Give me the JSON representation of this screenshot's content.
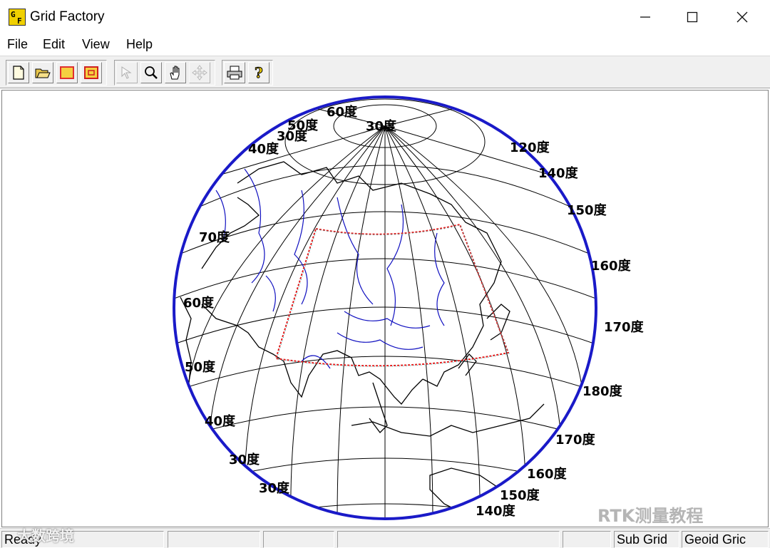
{
  "window": {
    "title": "Grid Factory",
    "icon": "grid-factory-icon",
    "icon_letters": [
      "G",
      "F"
    ],
    "controls": [
      "minimize",
      "maximize",
      "close"
    ]
  },
  "menu": [
    "File",
    "Edit",
    "View",
    "Help"
  ],
  "toolbar": {
    "groups": [
      [
        "new-file-icon",
        "open-folder-icon",
        "rectangle-icon",
        "sub-rectangle-icon"
      ],
      [
        "select-arrow-icon",
        "zoom-magnifier-icon",
        "pan-hand-icon",
        "move-crosshair-icon"
      ],
      [
        "print-icon",
        "help-question-icon"
      ]
    ]
  },
  "map": {
    "projection": "orthographic globe",
    "colors": {
      "coastline": "#000000",
      "rivers": "#1010c0",
      "rim": "#1a1ac8",
      "grid_box_red": "#e02020",
      "grid_box_cyan": "#10c0c0"
    },
    "labels": [
      "60度",
      "30度",
      "50度",
      "40度",
      "30度",
      "120度",
      "140度",
      "150度",
      "160度",
      "170度",
      "180度",
      "170度",
      "160度",
      "150度",
      "140度",
      "70度",
      "60度",
      "50度",
      "40度",
      "30度",
      "30度"
    ]
  },
  "status": {
    "ready": "Ready",
    "sub_grid": "Sub Grid",
    "geoid_grid": "Geoid Gric"
  },
  "watermarks": [
    "RTK测量教程",
    "大数跨境"
  ]
}
